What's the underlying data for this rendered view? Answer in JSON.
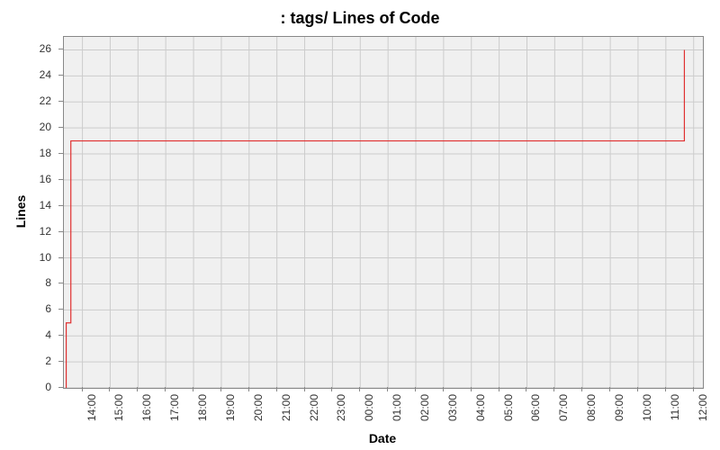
{
  "chart_data": {
    "type": "line",
    "title": ": tags/ Lines of Code",
    "xlabel": "Date",
    "ylabel": "Lines",
    "x_categories": [
      "14:00",
      "15:00",
      "16:00",
      "17:00",
      "18:00",
      "19:00",
      "20:00",
      "21:00",
      "22:00",
      "23:00",
      "00:00",
      "01:00",
      "02:00",
      "03:00",
      "04:00",
      "05:00",
      "06:00",
      "07:00",
      "08:00",
      "09:00",
      "10:00",
      "11:00",
      "12:00"
    ],
    "y_ticks": [
      0,
      2,
      4,
      6,
      8,
      10,
      12,
      14,
      16,
      18,
      20,
      22,
      24,
      26
    ],
    "ylim": [
      0,
      27
    ],
    "xlim_minutes": [
      -40,
      1340
    ],
    "series": [
      {
        "name": "Lines",
        "color": "#e03030",
        "points": [
          {
            "x_min": -35,
            "y": 0
          },
          {
            "x_min": -35,
            "y": 5
          },
          {
            "x_min": -25,
            "y": 5
          },
          {
            "x_min": -25,
            "y": 19
          },
          {
            "x_min": 1300,
            "y": 19
          },
          {
            "x_min": 1300,
            "y": 26
          }
        ]
      }
    ],
    "grid": true
  }
}
